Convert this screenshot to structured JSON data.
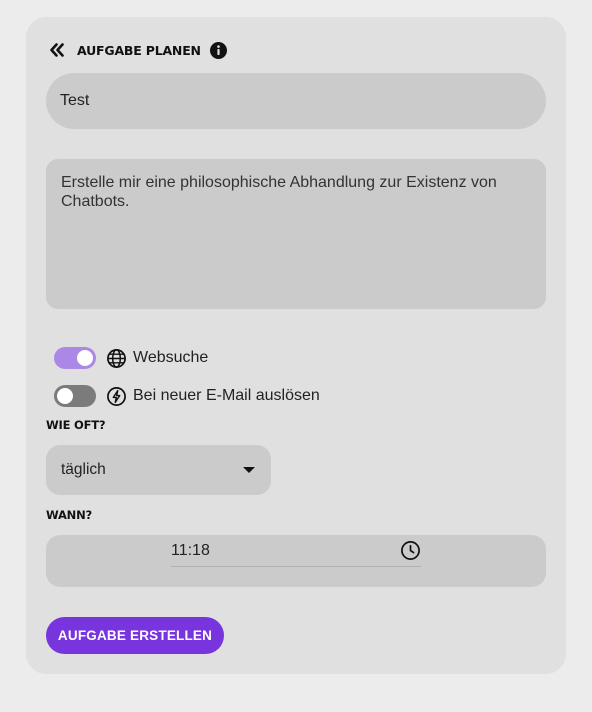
{
  "header": {
    "title": "AUFGABE PLANEN",
    "back_icon": "double-chevron-left-icon",
    "info_icon": "info-circle-icon"
  },
  "form": {
    "title_value": "Test",
    "prompt_value": "Erstelle mir eine philosophische Abhandlung zur Existenz von Chatbots.",
    "options": [
      {
        "label": "Websuche",
        "icon": "globe-icon",
        "enabled": true
      },
      {
        "label": "Bei neuer E-Mail auslösen",
        "icon": "lightning-icon",
        "enabled": false
      }
    ],
    "frequency": {
      "label": "WIE OFT?",
      "value": "täglich"
    },
    "time": {
      "label": "WANN?",
      "value": "11:18"
    },
    "submit_label": "AUFGABE ERSTELLEN"
  },
  "colors": {
    "accent": "#7834dd",
    "toggle_on": "#ab87e6",
    "toggle_off": "#7b7b7b",
    "field_bg": "#cbcbcb",
    "card_bg": "#e0e0e0"
  }
}
